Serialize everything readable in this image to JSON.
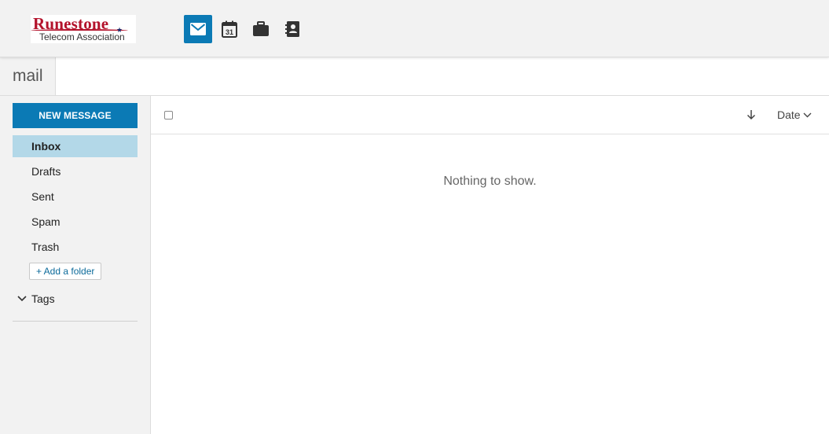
{
  "header": {
    "logo": {
      "main": "Runestone",
      "sub": "Telecom Association"
    },
    "apps": [
      {
        "name": "mail",
        "icon": "mail-icon",
        "active": true
      },
      {
        "name": "calendar",
        "icon": "calendar-icon",
        "day": "31"
      },
      {
        "name": "briefcase",
        "icon": "briefcase-icon"
      },
      {
        "name": "contacts",
        "icon": "contacts-icon"
      }
    ]
  },
  "title": {
    "app_name": "mail"
  },
  "sidebar": {
    "new_message_label": "NEW MESSAGE",
    "folders": [
      {
        "label": "Inbox",
        "active": true
      },
      {
        "label": "Drafts"
      },
      {
        "label": "Sent"
      },
      {
        "label": "Spam"
      },
      {
        "label": "Trash"
      }
    ],
    "add_folder_label": "+ Add a folder",
    "tags_label": "Tags"
  },
  "list": {
    "sort_field": "Date",
    "empty_message": "Nothing to show."
  },
  "colors": {
    "accent": "#0b7ab5",
    "selected_folder": "#b3d8e8",
    "logo_red": "#b3122b"
  }
}
